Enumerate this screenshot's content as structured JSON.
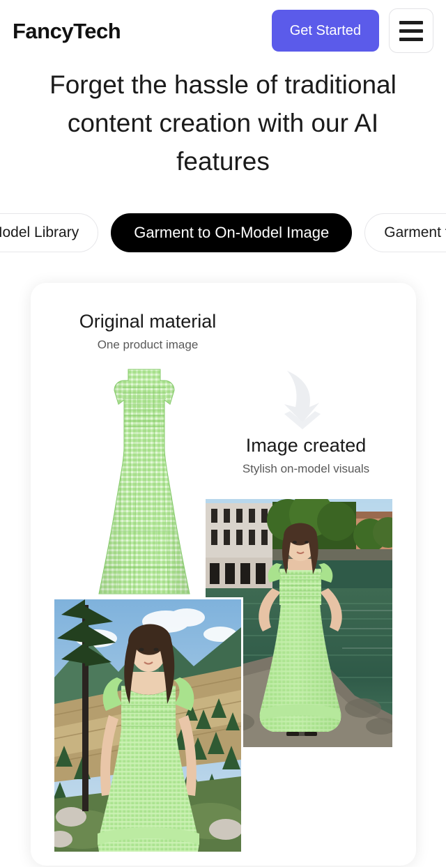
{
  "header": {
    "logo": "FancyTech",
    "cta_label": "Get Started",
    "menu_icon": "hamburger-menu-icon"
  },
  "hero": {
    "headline": "Forget the hassle of traditional content creation with our AI features"
  },
  "tabs": [
    {
      "label": "Model Library",
      "active": false,
      "truncated": true
    },
    {
      "label": "Garment to On-Model Image",
      "active": true,
      "truncated": false
    },
    {
      "label": "Garment to On-Model Video",
      "active": false,
      "truncated": true
    }
  ],
  "showcase": {
    "original": {
      "title": "Original material",
      "subtitle": "One product image",
      "image_name": "green-gingham-maxi-dress-product-photo"
    },
    "arrow_icon": "curved-down-arrow-icon",
    "created": {
      "title": "Image created",
      "subtitle": "Stylish on-model visuals",
      "images": [
        {
          "image_name": "model-in-green-dress-by-canal"
        },
        {
          "image_name": "model-in-green-dress-in-mountains"
        }
      ]
    }
  },
  "colors": {
    "accent": "#5b5bea",
    "active_tab_bg": "#000000",
    "page_bg": "#ffffff",
    "garment_green": "#8fd677",
    "text_primary": "#1a1a1a",
    "text_secondary": "#595959"
  }
}
